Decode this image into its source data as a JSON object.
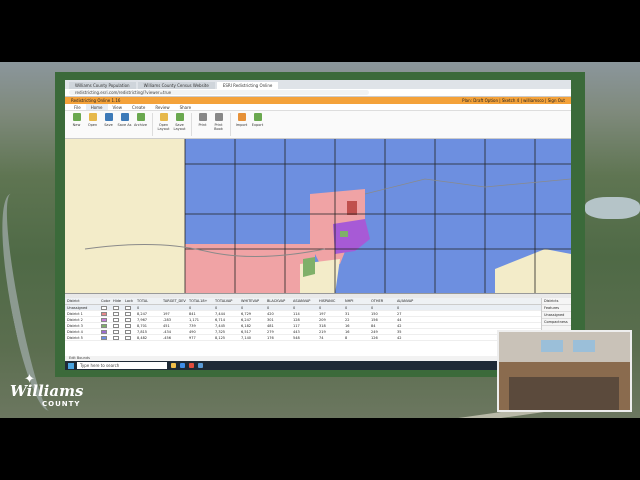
{
  "browser": {
    "tabs": [
      "Williams County Population",
      "Williams County Census Website",
      "ESRI Redistricting Online"
    ],
    "url": "redistricting.esri.com/redistricting/?viewer=true"
  },
  "app": {
    "title": "Redistricting Online 1.16",
    "user": "Plan: Draft Option | Sketch 4 | williamsco | Sign Out"
  },
  "ribbon": {
    "tabs": [
      "File",
      "Home",
      "View",
      "Create",
      "Review",
      "Share"
    ],
    "buttons": [
      {
        "label": "New",
        "icon": "new-icon",
        "color": "#6aa84f"
      },
      {
        "label": "Open",
        "icon": "open-icon",
        "color": "#e6b84a"
      },
      {
        "label": "Save",
        "icon": "save-icon",
        "color": "#3d7ab8"
      },
      {
        "label": "Save As",
        "icon": "save-as-icon",
        "color": "#3d7ab8"
      },
      {
        "label": "Archive",
        "icon": "archive-icon",
        "color": "#6aa84f"
      },
      {
        "label": "Open Layout",
        "icon": "open-layout-icon",
        "color": "#e6b84a"
      },
      {
        "label": "Save Layout",
        "icon": "save-layout-icon",
        "color": "#6aa84f"
      },
      {
        "label": "Print",
        "icon": "print-icon",
        "color": "#888888"
      },
      {
        "label": "Print Book",
        "icon": "print-book-icon",
        "color": "#888888"
      },
      {
        "label": "Import",
        "icon": "import-icon",
        "color": "#e69138"
      },
      {
        "label": "Export",
        "icon": "export-icon",
        "color": "#6aa84f"
      }
    ]
  },
  "table": {
    "columns": [
      "District",
      "Color",
      "Hide",
      "Lock",
      "TOTAL",
      "TARGET_DEV",
      "TOTAL18+",
      "TOTALVAP",
      "WHITEVAP",
      "BLACKVAP",
      "ASIANVAP",
      "HISPANIC",
      "NHPI",
      "OTHER",
      "AI/ANVAP"
    ],
    "rows": [
      {
        "name": "Unassigned",
        "color": "#ffffff",
        "values": [
          "0",
          "",
          "0",
          "0",
          "0",
          "0",
          "0",
          "0",
          "0",
          "0",
          "0"
        ]
      },
      {
        "name": "District 1",
        "color": "#e8888a",
        "values": [
          "8,247",
          "197",
          "841",
          "7,444",
          "6,729",
          "420",
          "114",
          "197",
          "31",
          "150",
          "27"
        ]
      },
      {
        "name": "District 2",
        "color": "#c77cdb",
        "values": [
          "7,967",
          "-283",
          "1,171",
          "6,714",
          "6,247",
          "301",
          "128",
          "209",
          "22",
          "156",
          "44"
        ]
      },
      {
        "name": "District 3",
        "color": "#7fb069",
        "values": [
          "8,701",
          "451",
          "739",
          "7,445",
          "6,182",
          "481",
          "117",
          "318",
          "16",
          "84",
          "42"
        ]
      },
      {
        "name": "District 4",
        "color": "#9c6bd1",
        "values": [
          "7,815",
          "-434",
          "490",
          "7,325",
          "6,517",
          "279",
          "443",
          "219",
          "16",
          "249",
          "35"
        ]
      },
      {
        "name": "District 5",
        "color": "#6d8fe0",
        "values": [
          "8,482",
          "-456",
          "977",
          "8,125",
          "7,140",
          "176",
          "548",
          "74",
          "8",
          "126",
          "42"
        ]
      }
    ],
    "footer": "Edit Bounds"
  },
  "side_panel": [
    "Districts",
    "Features",
    "Unassigned",
    "Compactness"
  ],
  "taskbar": {
    "search_placeholder": "Type here to search"
  },
  "logo": {
    "name": "Williams",
    "sub": "COUNTY"
  },
  "map": {
    "district_colors": {
      "blue": "#6d8fe0",
      "pink": "#f0a3a5",
      "purple": "#a75ad6",
      "tan": "#f3ecc9",
      "green": "#7fb069"
    }
  }
}
